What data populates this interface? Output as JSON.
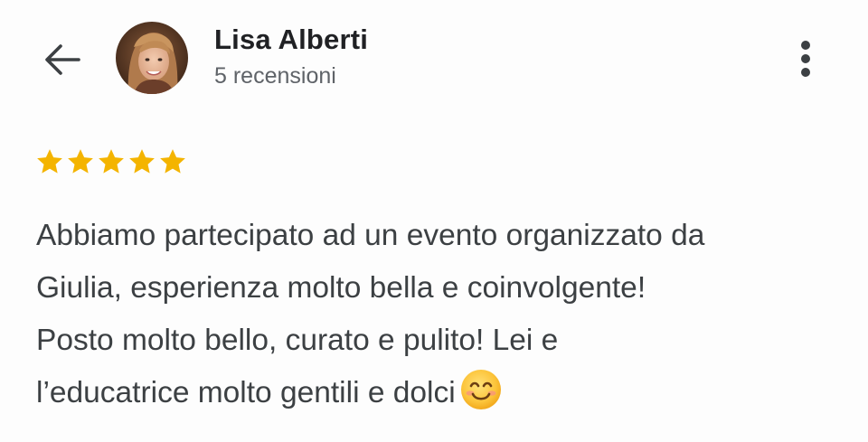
{
  "header": {
    "back_icon": "arrow-left-icon",
    "user_name": "Lisa Alberti",
    "review_count": "5 recensioni",
    "more_icon": "more-vert-icon",
    "avatar_icon": "user-avatar"
  },
  "review": {
    "rating": 5,
    "rating_max": 5,
    "star_color": "#f4b400",
    "lines": [
      "Abbiamo partecipato ad un evento organizzato da",
      "Giulia, esperienza molto bella e coinvolgente!",
      "Posto molto bello, curato e pulito! Lei e",
      "l’educatrice molto gentili e dolci"
    ],
    "emoji": "smiling-face-emoji"
  },
  "colors": {
    "text_primary": "#202124",
    "text_secondary": "#5f6368",
    "body_text": "#3c4043",
    "background": "#fdfdfd"
  }
}
